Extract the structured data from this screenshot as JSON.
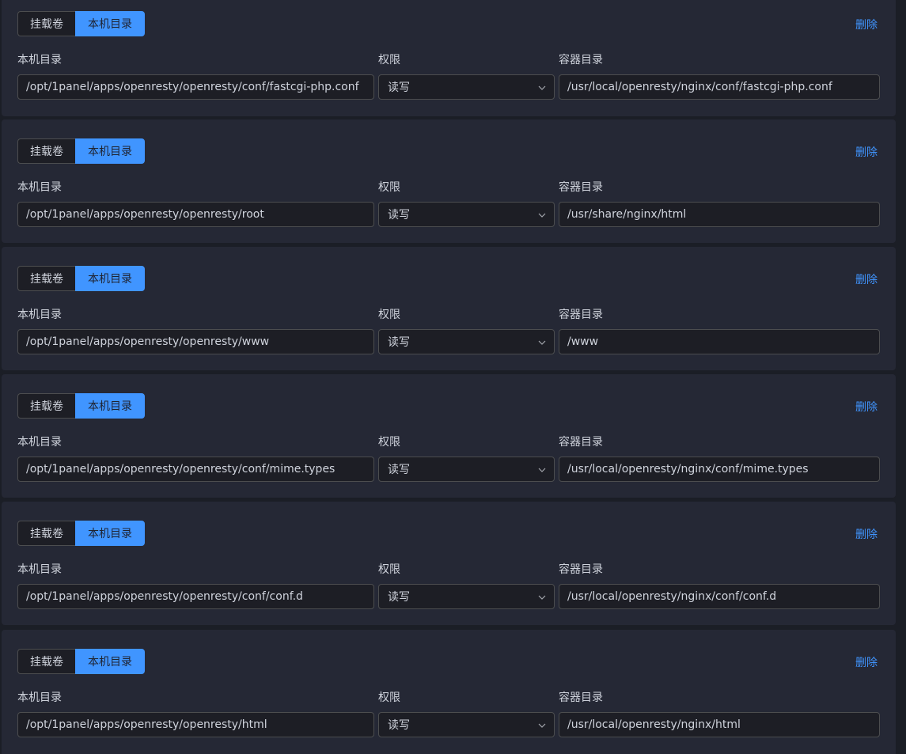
{
  "toggle": {
    "volume_label": "挂载卷",
    "host_label": "本机目录"
  },
  "delete_label": "删除",
  "labels": {
    "host_dir": "本机目录",
    "permission": "权限",
    "container_dir": "容器目录"
  },
  "mounts": [
    {
      "host": "/opt/1panel/apps/openresty/openresty/conf/fastcgi-php.conf",
      "mode": "读写",
      "container": "/usr/local/openresty/nginx/conf/fastcgi-php.conf"
    },
    {
      "host": "/opt/1panel/apps/openresty/openresty/root",
      "mode": "读写",
      "container": "/usr/share/nginx/html"
    },
    {
      "host": "/opt/1panel/apps/openresty/openresty/www",
      "mode": "读写",
      "container": "/www"
    },
    {
      "host": "/opt/1panel/apps/openresty/openresty/conf/mime.types",
      "mode": "读写",
      "container": "/usr/local/openresty/nginx/conf/mime.types"
    },
    {
      "host": "/opt/1panel/apps/openresty/openresty/conf/conf.d",
      "mode": "读写",
      "container": "/usr/local/openresty/nginx/conf/conf.d"
    },
    {
      "host": "/opt/1panel/apps/openresty/openresty/html",
      "mode": "读写",
      "container": "/usr/local/openresty/nginx/html"
    }
  ],
  "colors": {
    "accent": "#4095ff",
    "card_bg": "#252835",
    "page_bg": "#1b1e26",
    "input_bg": "#1d1e25",
    "border": "#4c4d4f"
  }
}
